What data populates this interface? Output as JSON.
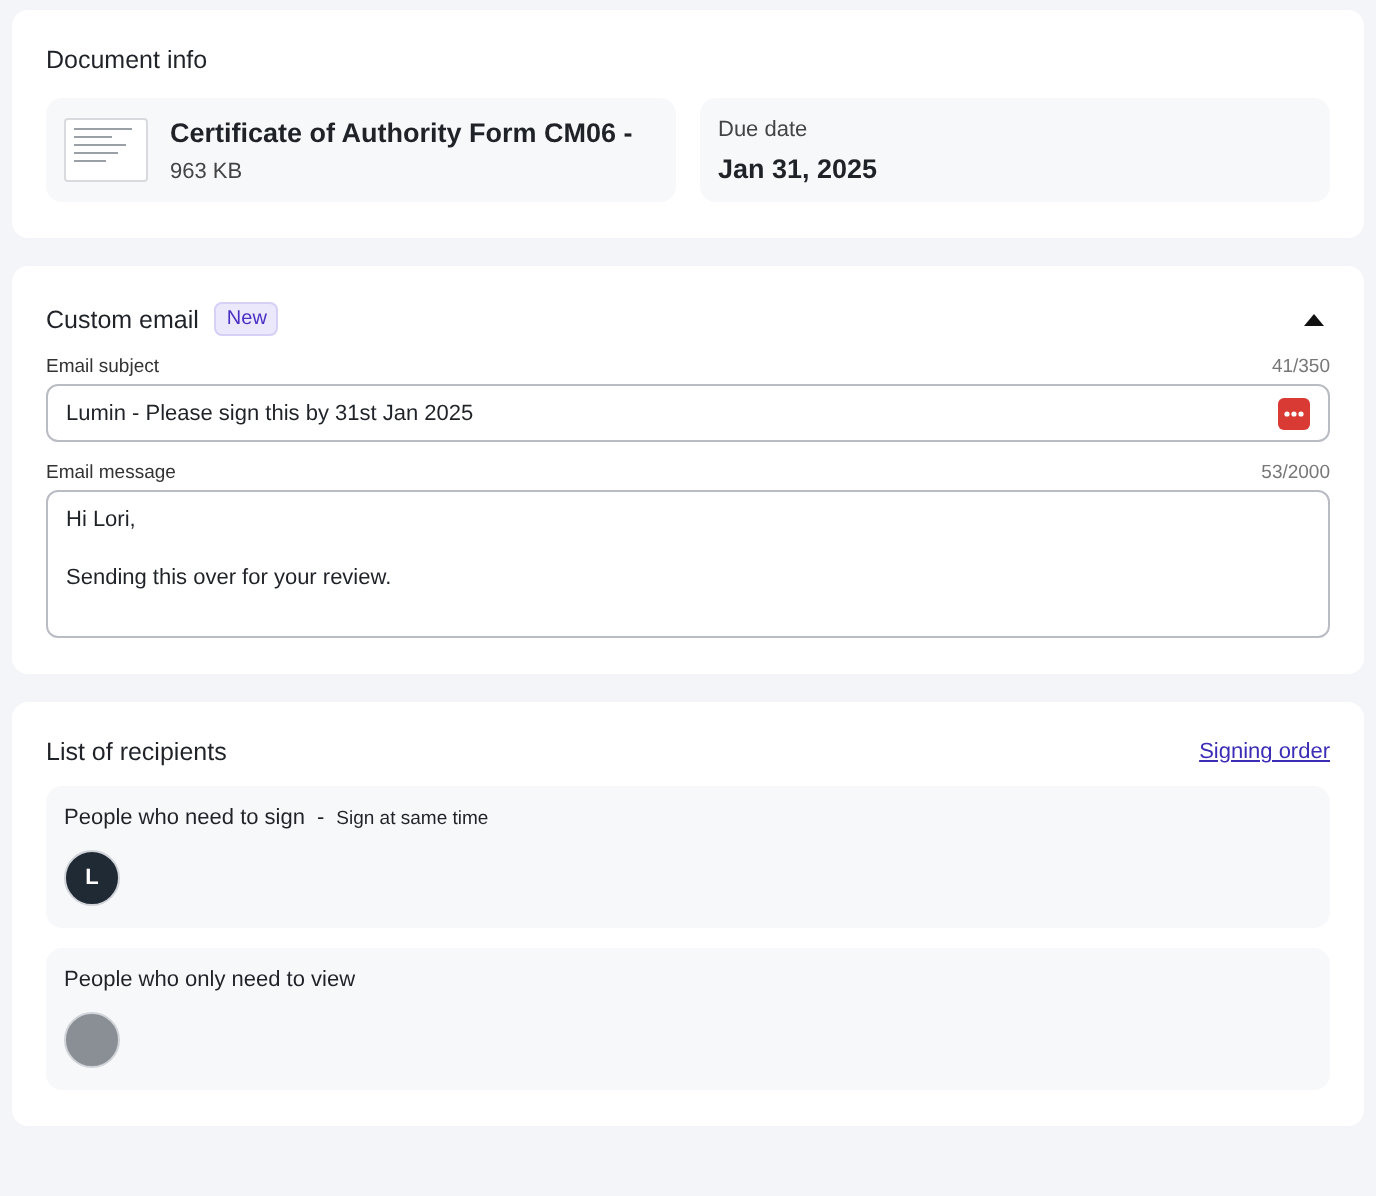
{
  "document_info": {
    "title": "Document info",
    "file": {
      "name": "Certificate of Authority Form CM06 -",
      "size": "963 KB"
    },
    "due": {
      "label": "Due date",
      "value": "Jan 31, 2025"
    }
  },
  "custom_email": {
    "title": "Custom email",
    "badge": "New",
    "expanded": true,
    "subject": {
      "label": "Email subject",
      "counter": "41/350",
      "value": "Lumin - Please sign this by 31st Jan 2025"
    },
    "message": {
      "label": "Email message",
      "counter": "53/2000",
      "paragraphs": [
        "Hi Lori,",
        "Sending this over for your review."
      ]
    }
  },
  "recipients": {
    "title": "List of recipients",
    "link": "Signing order",
    "groups": [
      {
        "title": "People who need to sign",
        "separator": "-",
        "note": "Sign at same time",
        "avatars": [
          {
            "kind": "initial",
            "text": "L"
          }
        ]
      },
      {
        "title": "People who only need to view",
        "avatars": [
          {
            "kind": "photo"
          }
        ]
      }
    ]
  }
}
